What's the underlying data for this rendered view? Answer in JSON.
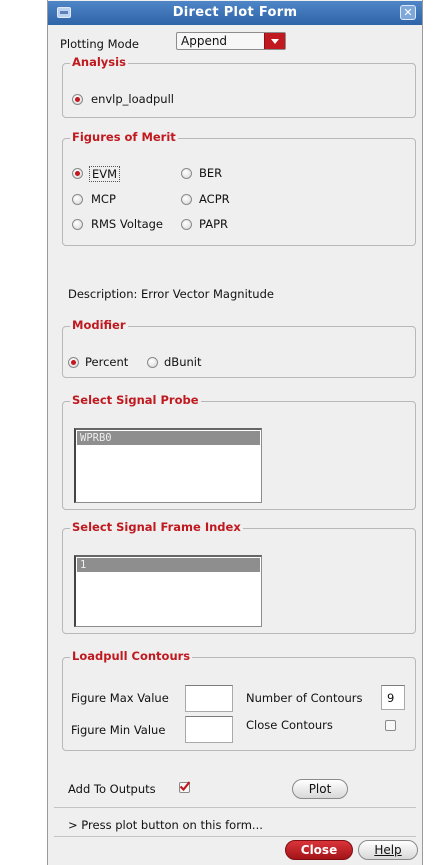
{
  "window": {
    "title": "Direct Plot Form",
    "close_glyph": "✕"
  },
  "plotting_mode": {
    "label": "Plotting Mode",
    "value": "Append"
  },
  "analysis": {
    "title": "Analysis",
    "option": "envlp_loadpull"
  },
  "figures_of_merit": {
    "title": "Figures of Merit",
    "options": [
      "EVM",
      "BER",
      "MCP",
      "ACPR",
      "RMS Voltage",
      "PAPR"
    ],
    "selected": "EVM"
  },
  "description": "Description: Error Vector Magnitude",
  "modifier": {
    "title": "Modifier",
    "options": [
      "Percent",
      "dBunit"
    ],
    "selected": "Percent"
  },
  "signal_probe": {
    "title": "Select Signal Probe",
    "items": [
      "WPRB0"
    ]
  },
  "frame_index": {
    "title": "Select Signal Frame Index",
    "items": [
      "1"
    ]
  },
  "loadpull": {
    "title": "Loadpull Contours",
    "max_label": "Figure Max Value",
    "min_label": "Figure Min Value",
    "contours_label": "Number of Contours",
    "contours_value": "9",
    "close_label": "Close Contours"
  },
  "add_to_outputs": {
    "label": "Add To Outputs",
    "checked": true
  },
  "buttons": {
    "plot": "Plot",
    "close": "Close",
    "help": "Help"
  },
  "status": "> Press plot button on this form...",
  "icons": [
    "window-menu-icon",
    "window-close-icon",
    "dropdown-arrow-icon",
    "checkmark-icon"
  ],
  "colors": {
    "accent": "#c0191f",
    "titlebar": "#3a70b5"
  }
}
